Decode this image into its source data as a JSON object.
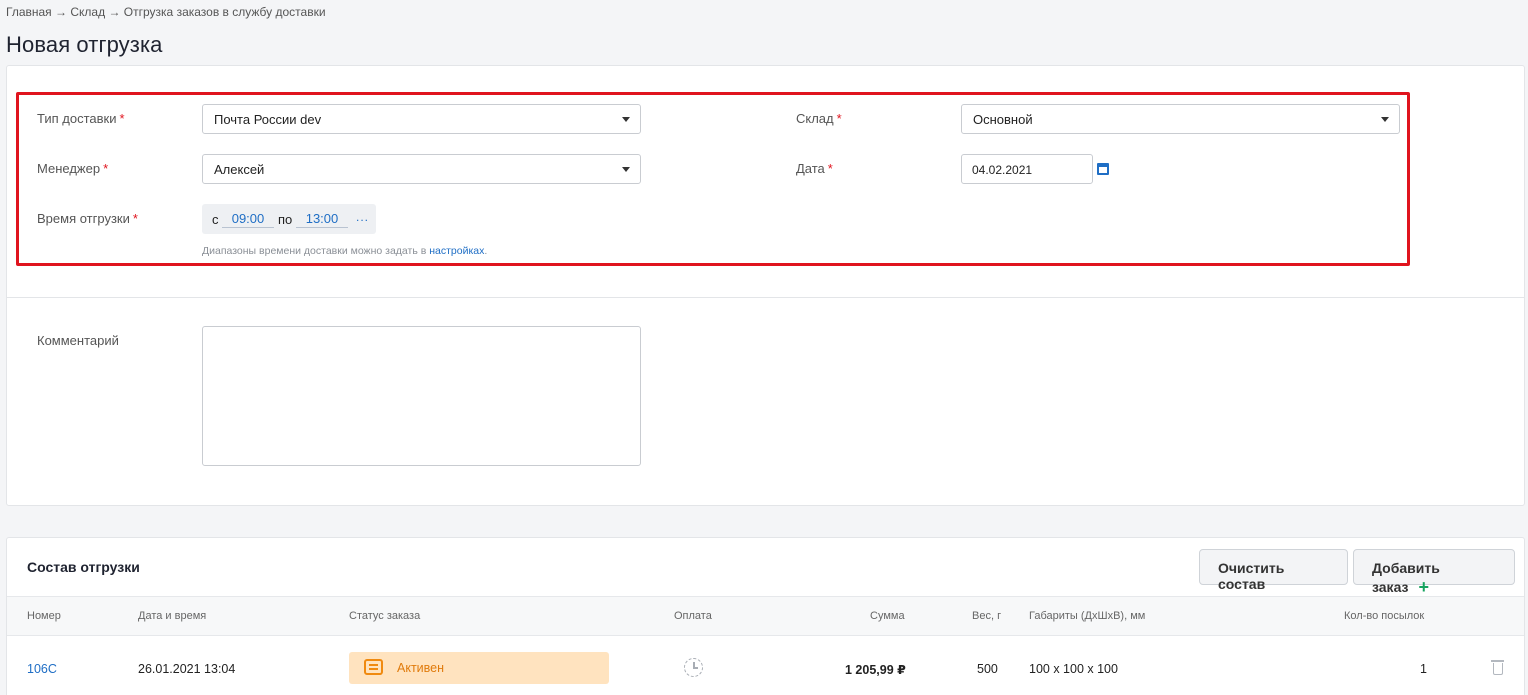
{
  "breadcrumb": {
    "items": [
      "Главная",
      "Склад",
      "Отгрузка заказов в службу доставки"
    ],
    "separator": "→"
  },
  "page": {
    "title": "Новая отгрузка"
  },
  "form": {
    "required_mark": "*",
    "delivery_type": {
      "label": "Тип доставки",
      "value": "Почта России dev"
    },
    "warehouse": {
      "label": "Склад",
      "value": "Основной"
    },
    "manager": {
      "label": "Менеджер",
      "value": "Алексей"
    },
    "date": {
      "label": "Дата",
      "value": "04.02.2021"
    },
    "shipment_time": {
      "label": "Время отгрузки",
      "from_prefix": "с",
      "from": "09:00",
      "to_prefix": "по",
      "to": "13:00",
      "more": "..."
    },
    "hint": {
      "text": "Диапазоны времени доставки можно задать в",
      "link": "настройках",
      "end": "."
    },
    "comment": {
      "label": "Комментарий",
      "value": ""
    }
  },
  "shipment": {
    "title": "Состав отгрузки",
    "clear_button": "Очистить состав",
    "add_button": "Добавить заказ",
    "add_icon": "+",
    "columns": [
      "Номер",
      "Дата и время",
      "Статус заказа",
      "Оплата",
      "Сумма",
      "Вес, г",
      "Габариты (ДхШхВ), мм",
      "Кол-во посылок"
    ],
    "rows": [
      {
        "number": "106C",
        "datetime": "26.01.2021 13:04",
        "status": "Активен",
        "payment_icon": "clock-pending-icon",
        "sum": "1 205,99 ₽",
        "weight": "500",
        "dimensions": "100 х 100 х 100",
        "parcels": "1"
      }
    ]
  },
  "colors": {
    "accent": "#1f6ec5",
    "required": "#e0141e",
    "status_bg": "#ffe3bf",
    "status_text": "#e07b0c",
    "add_icon": "#16a35f"
  }
}
